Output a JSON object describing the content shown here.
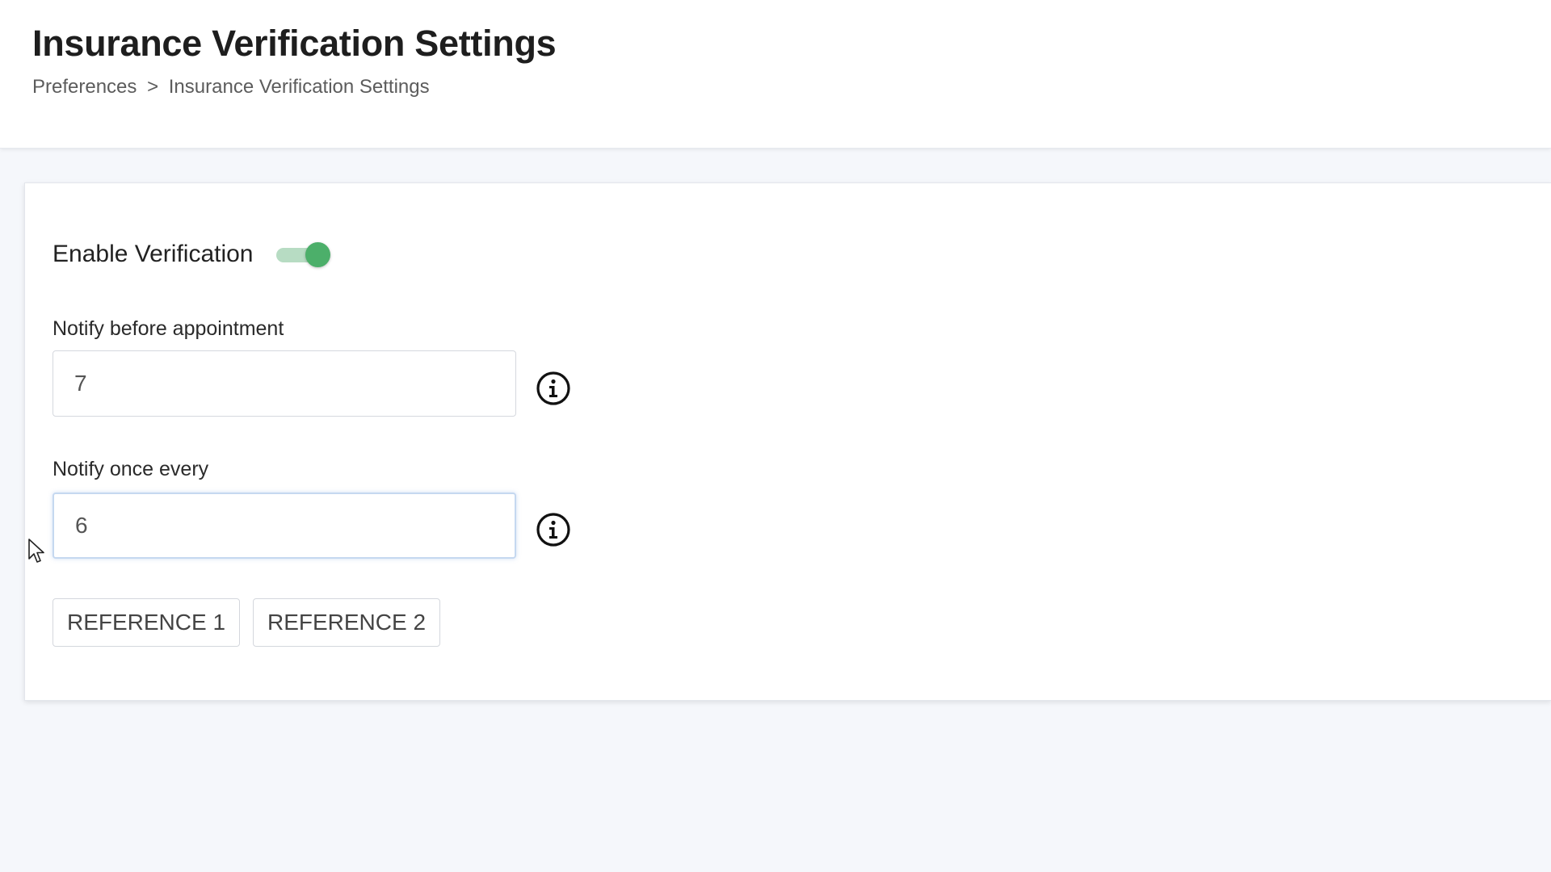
{
  "header": {
    "title": "Insurance Verification Settings",
    "breadcrumb": {
      "parent": "Preferences",
      "separator": ">",
      "current": "Insurance Verification Settings"
    }
  },
  "settings": {
    "enable_verification": {
      "label": "Enable Verification",
      "enabled": true,
      "accent_color": "#4caf6a"
    },
    "notify_before": {
      "label": "Notify before appointment",
      "value": "7",
      "icon": "info-icon"
    },
    "notify_every": {
      "label": "Notify once every",
      "value": "6",
      "icon": "info-icon"
    },
    "buttons": {
      "reference1": "REFERENCE 1",
      "reference2": "REFERENCE 2"
    }
  }
}
